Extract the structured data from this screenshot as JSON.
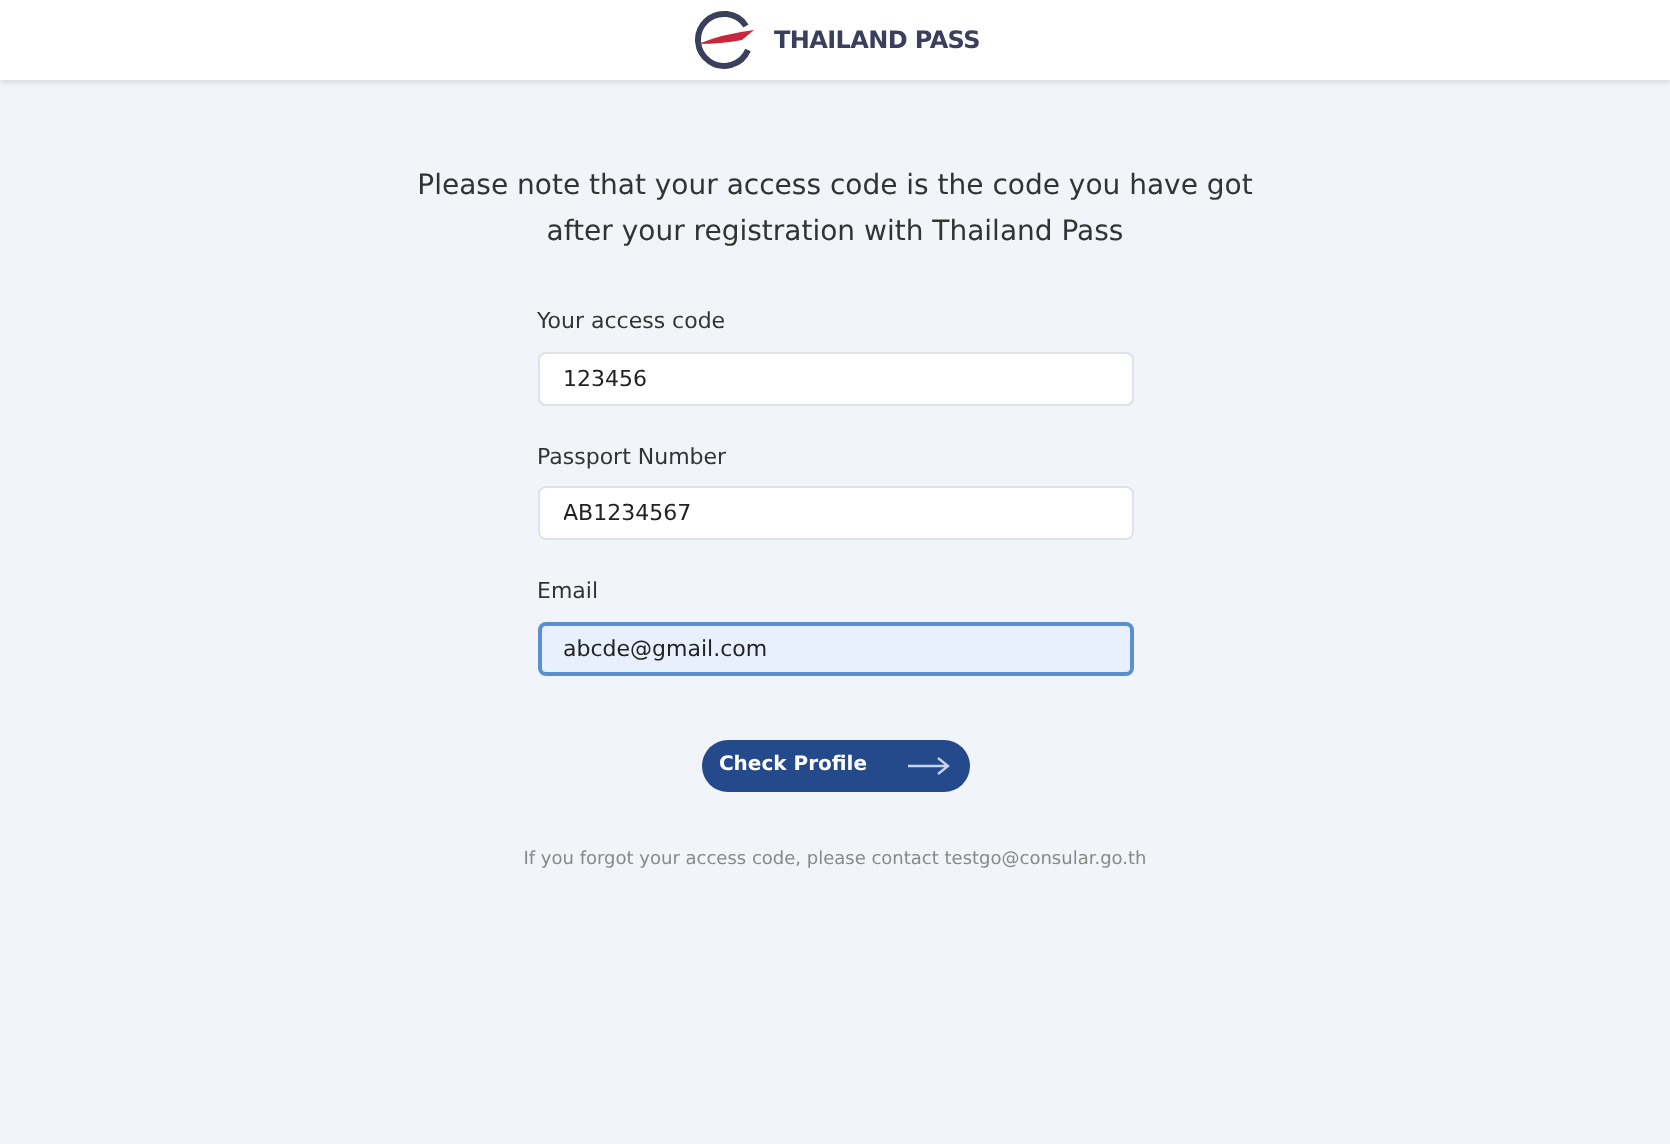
{
  "header": {
    "brand": "THAILAND PASS"
  },
  "notice": "Please note that your access code is the code you have got after your registration with Thailand Pass",
  "fields": [
    {
      "label": "Your access code",
      "value": "123456",
      "focused": false
    },
    {
      "label": "Passport Number",
      "value": "AB1234567",
      "focused": false
    },
    {
      "label": "Email",
      "value": "abcde@gmail.com",
      "focused": true
    }
  ],
  "submit": {
    "label": "Check Profile"
  },
  "footer_note": "If you forgot your access code, please contact testgo@consular.go.th"
}
